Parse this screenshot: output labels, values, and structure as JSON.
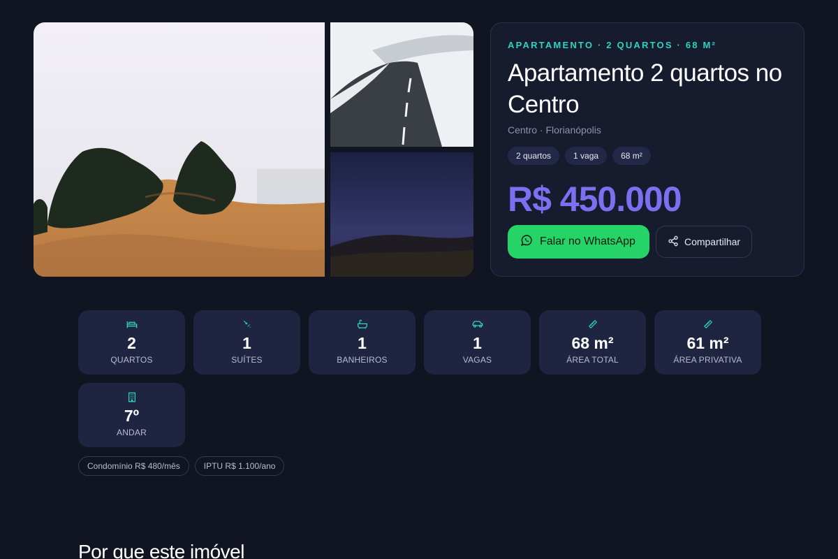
{
  "gallery": {
    "photos": [
      {
        "name": "foggy-hill-with-trees"
      },
      {
        "name": "snowy-road"
      },
      {
        "name": "night-sky-landscape"
      }
    ]
  },
  "listing": {
    "eyebrow": "APARTAMENTO · 2 QUARTOS · 68 M²",
    "title": "Apartamento 2 quartos no Centro",
    "location": "Centro · Florianópolis",
    "chips": [
      "2 quartos",
      "1 vaga",
      "68 m²"
    ],
    "price": "R$ 450.000",
    "whatsapp_label": "Falar no WhatsApp",
    "share_label": "Compartilhar"
  },
  "features": [
    {
      "icon": "bed-icon",
      "value": "2",
      "label": "QUARTOS"
    },
    {
      "icon": "shower-icon",
      "value": "1",
      "label": "SUÍTES"
    },
    {
      "icon": "bathtub-icon",
      "value": "1",
      "label": "BANHEIROS"
    },
    {
      "icon": "car-icon",
      "value": "1",
      "label": "VAGAS"
    },
    {
      "icon": "ruler-icon",
      "value": "68 m²",
      "label": "ÁREA TOTAL"
    },
    {
      "icon": "ruler-icon",
      "value": "61 m²",
      "label": "ÁREA PRIVATIVA"
    },
    {
      "icon": "building-icon",
      "value": "7º",
      "label": "ANDAR"
    }
  ],
  "fees": [
    "Condomínio R$ 480/mês",
    "IPTU R$ 1.100/ano"
  ],
  "section": {
    "title": "Por que este imóvel"
  },
  "colors": {
    "accent": "#7c6ff0",
    "teal": "#2dd4bf",
    "whatsapp": "#25d366",
    "background": "#111421"
  }
}
